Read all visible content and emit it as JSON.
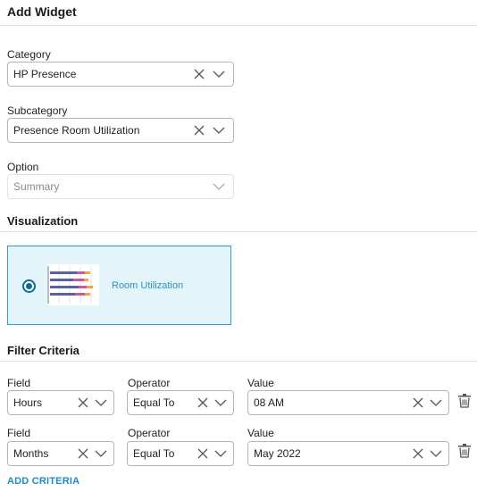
{
  "header": {
    "title": "Add Widget"
  },
  "category": {
    "label": "Category",
    "value": "HP Presence"
  },
  "subcategory": {
    "label": "Subcategory",
    "value": "Presence Room Utilization"
  },
  "option": {
    "label": "Option",
    "value": "Summary"
  },
  "visualization": {
    "heading": "Visualization",
    "options": [
      {
        "label": "Room Utilization",
        "selected": true
      }
    ]
  },
  "filter": {
    "heading": "Filter Criteria",
    "rows": [
      {
        "field_label": "Field",
        "field_value": "Hours",
        "operator_label": "Operator",
        "operator_value": "Equal To",
        "value_label": "Value",
        "value_value": "08 AM"
      },
      {
        "field_label": "Field",
        "field_value": "Months",
        "operator_label": "Operator",
        "operator_value": "Equal To",
        "value_label": "Value",
        "value_value": "May 2022"
      }
    ],
    "add_label": "ADD CRITERIA"
  },
  "icons": {
    "clear": "close-icon",
    "dropdown": "chevron-down-icon",
    "delete": "trash-icon",
    "radio": "radio-selected-icon"
  },
  "colors": {
    "accent": "#1f8bc7",
    "card_bg": "#e3f4fb",
    "card_border": "#2c9fd0",
    "radio": "#0b6e94"
  }
}
